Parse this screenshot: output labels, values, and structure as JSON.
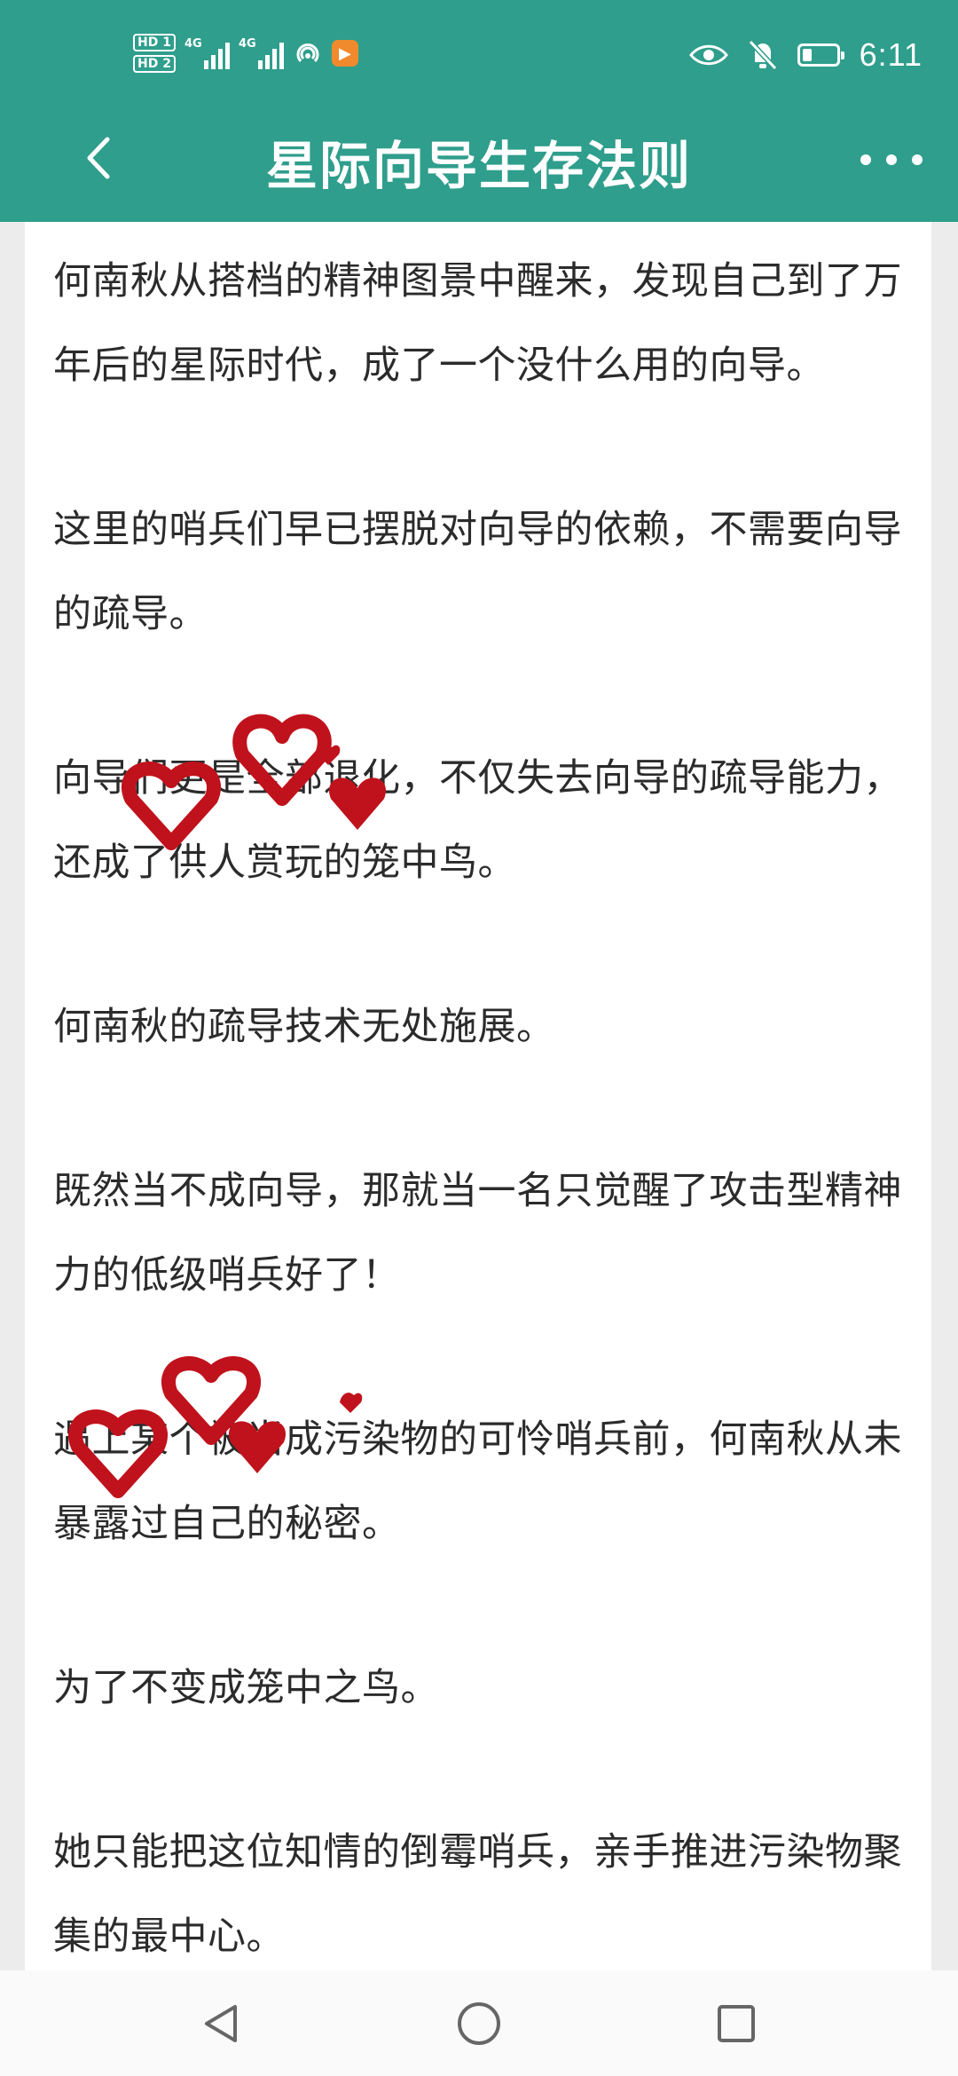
{
  "status_bar": {
    "hd1": "HD 1",
    "hd2": "HD 2",
    "signal1": "4G",
    "signal2": "4G",
    "time": "6:11",
    "battery_level": 0.3
  },
  "nav": {
    "title": "星际向导生存法则",
    "back_icon": "chevron-left-icon",
    "more_icon": "more-dots-icon"
  },
  "paragraphs": [
    "何南秋从搭档的精神图景中醒来，发现自己到了万年后的星际时代，成了一个没什么用的向导。",
    "这里的哨兵们早已摆脱对向导的依赖，不需要向导的疏导。",
    "向导们更是全部退化，不仅失去向导的疏导能力，还成了供人赏玩的笼中鸟。",
    "何南秋的疏导技术无处施展。",
    "既然当不成向导，那就当一名只觉醒了攻击型精神力的低级哨兵好了！",
    "遇上某个被当成污染物的可怜哨兵前，何南秋从未暴露过自己的秘密。",
    "为了不变成笼中之鸟。",
    "她只能把这位知情的倒霉哨兵，亲手推进污染物聚集的最中心。"
  ],
  "colors": {
    "header": "#2f9e8c",
    "page_bg": "#ffffff",
    "text": "#2b2b2b",
    "doodle": "#c0121c"
  },
  "system_nav": {
    "back": "triangle-back-icon",
    "home": "circle-home-icon",
    "recents": "square-recents-icon"
  }
}
